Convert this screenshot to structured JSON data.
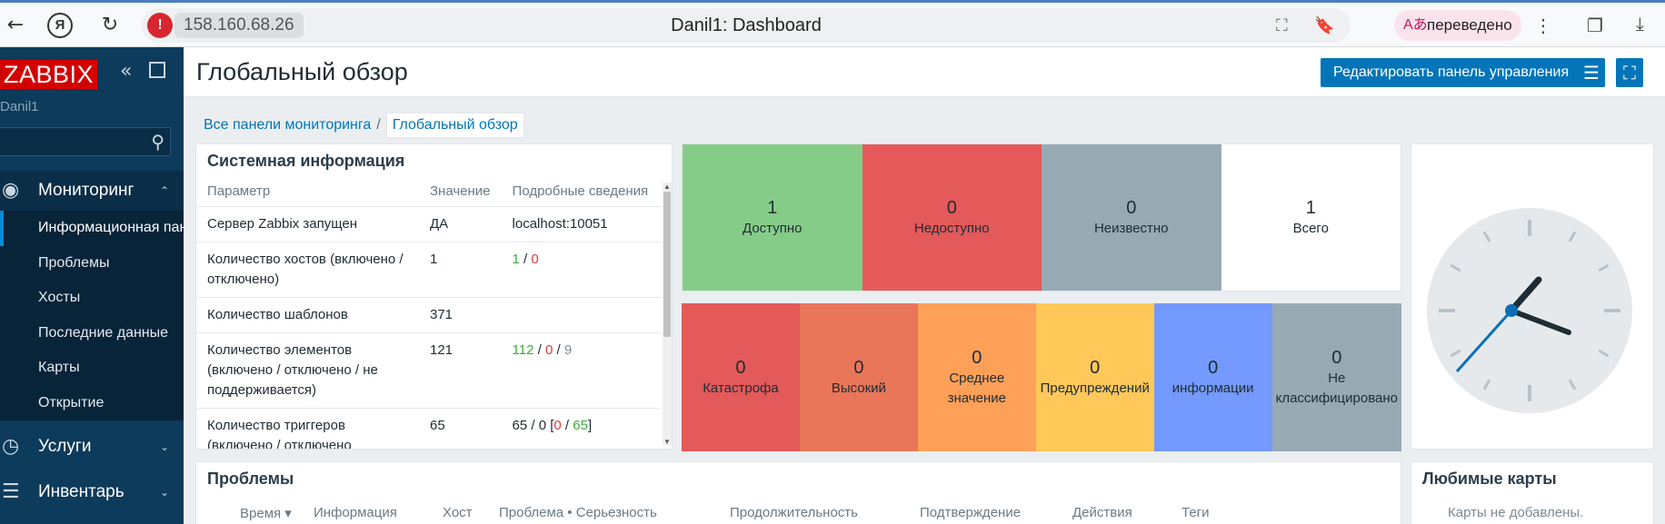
{
  "browser": {
    "back_icon": "back-arrow-icon",
    "reload_icon": "reload-icon",
    "address": "158.160.68.26",
    "tab_title": "Danil1: Dashboard",
    "translate_label": "переведено"
  },
  "sidebar": {
    "logo": "ZABBIX",
    "user": "Danil1",
    "search_placeholder": "",
    "monitoring_label": "Мониторинг",
    "monitoring_items": [
      {
        "label": "Информационная панель"
      },
      {
        "label": "Проблемы"
      },
      {
        "label": "Хосты"
      },
      {
        "label": "Последние данные"
      },
      {
        "label": "Карты"
      },
      {
        "label": "Открытие"
      }
    ],
    "services_label": "Услуги",
    "inventory_label": "Инвентарь"
  },
  "header": {
    "title": "Глобальный обзор",
    "edit_button": "Редактировать панель управления"
  },
  "breadcrumb": {
    "all": "Все панели мониторинга",
    "sep": "/",
    "current": "Глобальный обзор"
  },
  "sysinfo": {
    "title": "Системная информация",
    "headers": [
      "Параметр",
      "Значение",
      "Подробные сведения"
    ],
    "rows": [
      {
        "param": "Сервер Zabbix запущен",
        "value": "ДА",
        "details": "localhost:10051"
      },
      {
        "param": "Количество хостов (включено / отключено)",
        "value": "1",
        "d1": "1",
        "d2": "0"
      },
      {
        "param": "Количество шаблонов",
        "value": "371"
      },
      {
        "param": "Количество элементов (включено / отключено / не поддерживается)",
        "value": "121",
        "d1": "112",
        "d2": "0",
        "d3": "9"
      },
      {
        "param": "Количество триггеров (включено / отключено [проблема / ok])",
        "value": "65",
        "d1": "65",
        "d2": "0",
        "d3": "0",
        "d4": "65"
      }
    ]
  },
  "host_availability": [
    {
      "count": "1",
      "label": "Доступно",
      "color": "#86cc89"
    },
    {
      "count": "0",
      "label": "Недоступно",
      "color": "#e45959"
    },
    {
      "count": "0",
      "label": "Неизвестно",
      "color": "#97aab3"
    },
    {
      "count": "1",
      "label": "Всего",
      "color": "#ffffff"
    }
  ],
  "problems_by_severity": [
    {
      "count": "0",
      "label": "Катастрофа",
      "color": "#e45959"
    },
    {
      "count": "0",
      "label": "Высокий",
      "color": "#e97659"
    },
    {
      "count": "0",
      "label": "Среднее значение",
      "color": "#ffa059"
    },
    {
      "count": "0",
      "label": "Предупреждений",
      "color": "#ffc859"
    },
    {
      "count": "0",
      "label": "информации",
      "color": "#7499ff"
    },
    {
      "count": "0",
      "label": "Не классифицировано",
      "color": "#97aab3"
    }
  ],
  "problems": {
    "title": "Проблемы",
    "columns": [
      "Время ▾",
      "Информация",
      "Хост",
      "Проблема • Серьезность",
      "Продолжительность",
      "Подтверждение",
      "Действия",
      "Теги"
    ]
  },
  "favmaps": {
    "title": "Любимые карты",
    "empty": "Карты не добавлены."
  }
}
